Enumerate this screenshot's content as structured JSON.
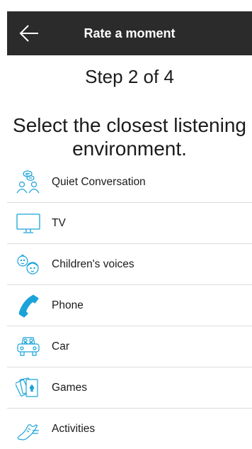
{
  "header": {
    "title": "Rate a moment",
    "background": "#2b2b2b"
  },
  "step_text": "Step 2 of 4",
  "prompt": "Select the closest listening environment.",
  "accent_color": "#1aa3d9",
  "environments": [
    {
      "label": "Quiet Conversation",
      "icon": "conversation-icon"
    },
    {
      "label": "TV",
      "icon": "tv-icon"
    },
    {
      "label": "Children's voices",
      "icon": "children-icon"
    },
    {
      "label": "Phone",
      "icon": "phone-icon"
    },
    {
      "label": "Car",
      "icon": "car-icon"
    },
    {
      "label": "Games",
      "icon": "cards-icon"
    },
    {
      "label": "Activities",
      "icon": "shoe-icon"
    }
  ]
}
